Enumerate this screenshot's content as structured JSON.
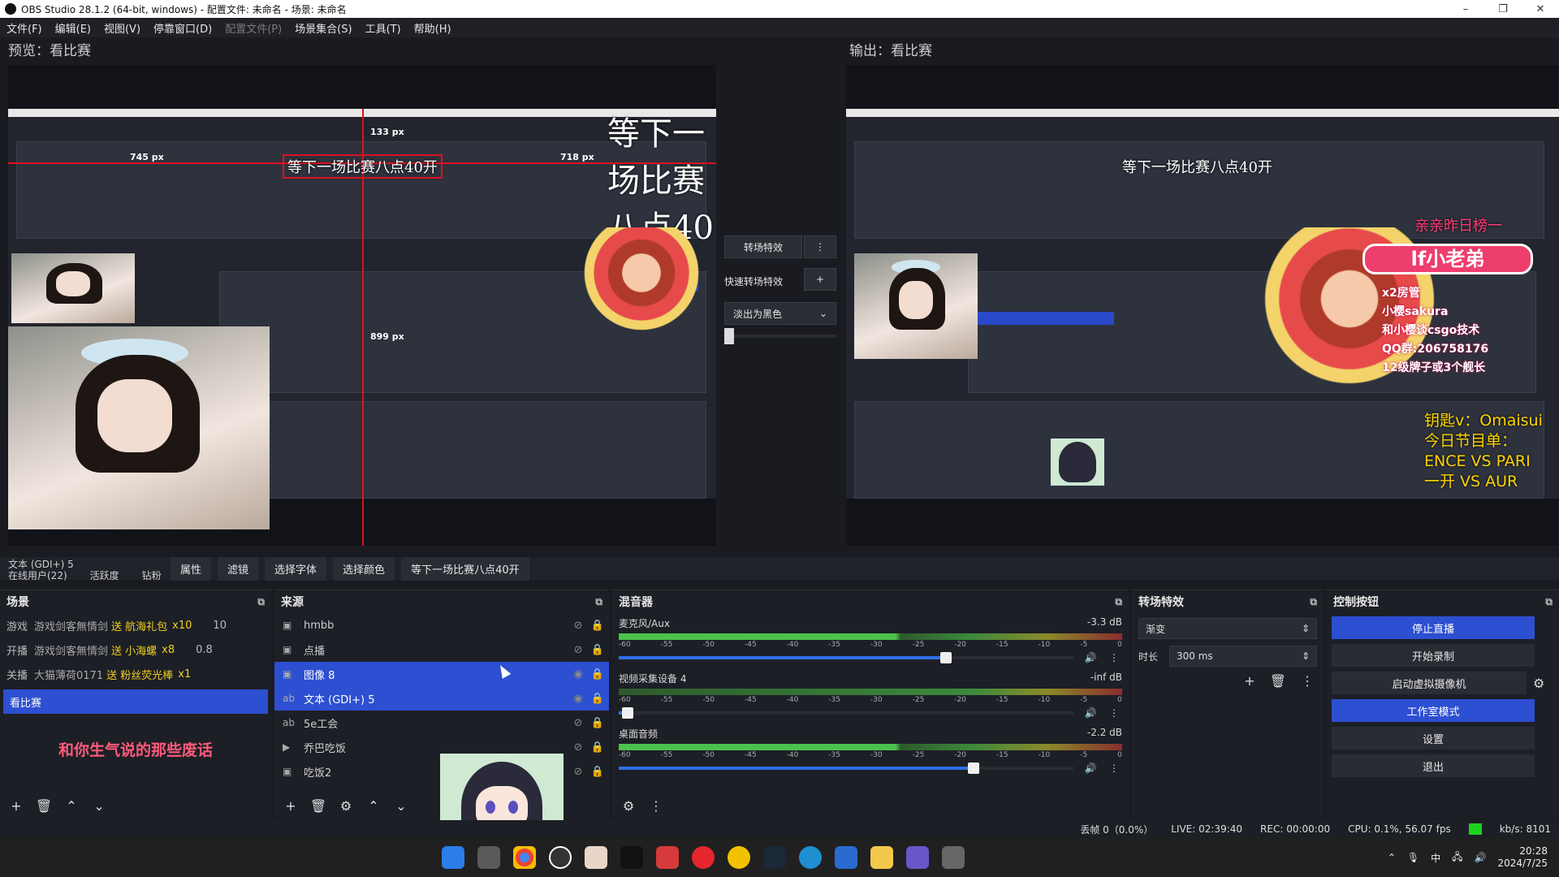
{
  "window": {
    "title": "OBS Studio 28.1.2 (64-bit, windows) - 配置文件: 未命名 - 场景: 未命名",
    "controls": [
      "–",
      "❐",
      "✕"
    ]
  },
  "menu": {
    "items": [
      "文件(F)",
      "编辑(E)",
      "视图(V)",
      "停靠窗口(D)",
      "配置文件(P)",
      "场景集合(S)",
      "工具(T)",
      "帮助(H)"
    ]
  },
  "preview": {
    "header": "预览：看比赛",
    "overlay_text": "等下一场比赛八点40开",
    "rulers": [
      "133 px",
      "745 px",
      "718 px",
      "899 px"
    ],
    "nested_header": "输出：看比赛"
  },
  "program": {
    "header": "输出：看比赛",
    "overlay_text": "等下一场比赛八点40开",
    "banner_top": "亲亲昨日榜一",
    "banner_name": "lf小老弟",
    "sidebar_lines": [
      "x2房管",
      "小樱sakura",
      "和小樱谈csgo技术",
      "QQ群:206758176",
      "12级牌子或3个舰长"
    ],
    "schedule_lines": [
      "钥匙v：Omaisui",
      "今日节目单：",
      "ENCE VS PARI",
      "一开 VS AUR"
    ]
  },
  "transition_mid": {
    "btn_transition": "转场特效",
    "quick_label": "快速转场特效",
    "fade_select": "淡出为黑色",
    "more": "⋮",
    "add": "+"
  },
  "context_bar": {
    "buttons": [
      "属性",
      "滤镜",
      "选择字体",
      "选择颜色",
      "等下一场比赛八点40开"
    ],
    "webcam_overlay_lines": [
      "文本 (GDI+) 5",
      "在线用户(22)",
      "活跃度",
      "钻粉"
    ]
  },
  "scenes": {
    "title": "场景",
    "gift_rows": [
      {
        "user": "游戏剑客無情剑",
        "gift": "送 航海礼包",
        "count": "x10",
        "val": "10"
      },
      {
        "user": "游戏剑客無情剑",
        "gift": "送 小海螺",
        "count": "x8",
        "val": "0.8"
      },
      {
        "user": "大猫薄荷0171",
        "gift": "送 粉丝荧光棒",
        "count": "x1",
        "val": ""
      }
    ],
    "row_labels": [
      "游戏",
      "开播",
      "关播"
    ],
    "selected": "看比赛",
    "footer_text": "和你生气说的那些废话"
  },
  "sources": {
    "title": "来源",
    "items": [
      {
        "icon": "image",
        "name": "hmbb",
        "visible": false,
        "selected": false
      },
      {
        "icon": "image",
        "name": "点播",
        "visible": false,
        "selected": false
      },
      {
        "icon": "image",
        "name": "图像 8",
        "visible": true,
        "selected": true
      },
      {
        "icon": "text",
        "name": "文本 (GDI+) 5",
        "visible": true,
        "selected": true
      },
      {
        "icon": "text",
        "name": "5e工会",
        "visible": false,
        "selected": false
      },
      {
        "icon": "media",
        "name": "乔巴吃饭",
        "visible": false,
        "selected": false
      },
      {
        "icon": "image",
        "name": "吃饭2",
        "visible": false,
        "selected": false
      }
    ]
  },
  "mixer": {
    "title": "混音器",
    "ticks": [
      "-60",
      "-55",
      "-50",
      "-45",
      "-40",
      "-35",
      "-30",
      "-25",
      "-20",
      "-15",
      "-10",
      "-5",
      "0"
    ],
    "channels": [
      {
        "name": "麦克风/Aux",
        "db": "-3.3 dB",
        "level": 0.72,
        "active": true
      },
      {
        "name": "视频采集设备 4",
        "db": "-inf dB",
        "level": 0.02,
        "active": false
      },
      {
        "name": "桌面音频",
        "db": "-2.2 dB",
        "level": 0.78,
        "active": true
      }
    ]
  },
  "transitions": {
    "title": "转场特效",
    "type": "渐变",
    "duration_label": "时长",
    "duration": "300 ms"
  },
  "controls": {
    "title": "控制按钮",
    "buttons": [
      {
        "label": "停止直播",
        "active": true
      },
      {
        "label": "开始录制",
        "active": false
      },
      {
        "label": "启动虚拟摄像机",
        "active": false
      },
      {
        "label": "工作室模式",
        "active": true
      },
      {
        "label": "设置",
        "active": false
      },
      {
        "label": "退出",
        "active": false
      }
    ]
  },
  "status": {
    "dropped": "丢帧 0（0.0%）",
    "live": "LIVE: 02:39:40",
    "rec": "REC: 00:00:00",
    "cpu": "CPU: 0.1%, 56.07 fps",
    "kbps": "kb/s: 8101",
    "status_color": "#1ed31e"
  },
  "taskbar": {
    "time": "20:28",
    "date": "2024/7/25",
    "ime": "中"
  }
}
